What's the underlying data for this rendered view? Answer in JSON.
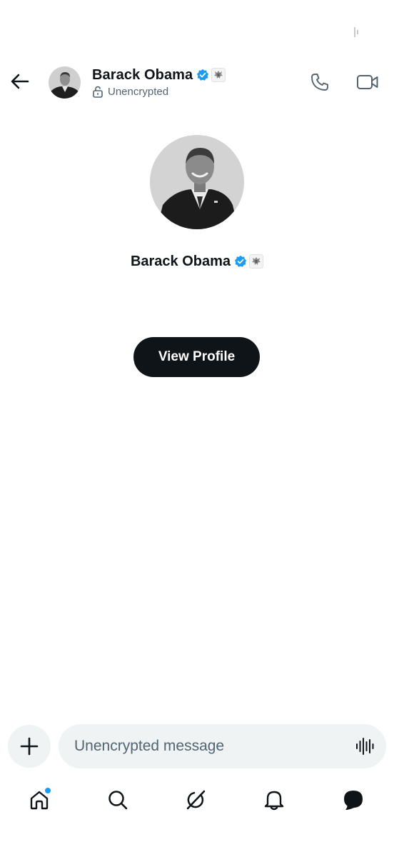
{
  "header": {
    "name": "Barack Obama",
    "encryption_status": "Unencrypted"
  },
  "profile": {
    "name": "Barack Obama",
    "view_profile_label": "View Profile"
  },
  "composer": {
    "placeholder": "Unencrypted message"
  },
  "icons": {
    "back": "arrow-left-icon",
    "verified": "verified-badge-icon",
    "affiliation": "government-seal-icon",
    "lock": "unlock-icon",
    "call": "phone-icon",
    "video": "video-camera-icon",
    "add": "plus-icon",
    "voice": "voice-waveform-icon",
    "home": "home-icon",
    "search": "search-icon",
    "grok": "grok-icon",
    "notifications": "bell-icon",
    "messages": "message-bubble-icon"
  },
  "colors": {
    "accent": "#1d9bf0",
    "text_primary": "#0f1419",
    "text_secondary": "#536471",
    "field_bg": "#eff3f4",
    "button_bg": "#0f1419"
  },
  "tabbar": {
    "home_has_notification": true
  }
}
